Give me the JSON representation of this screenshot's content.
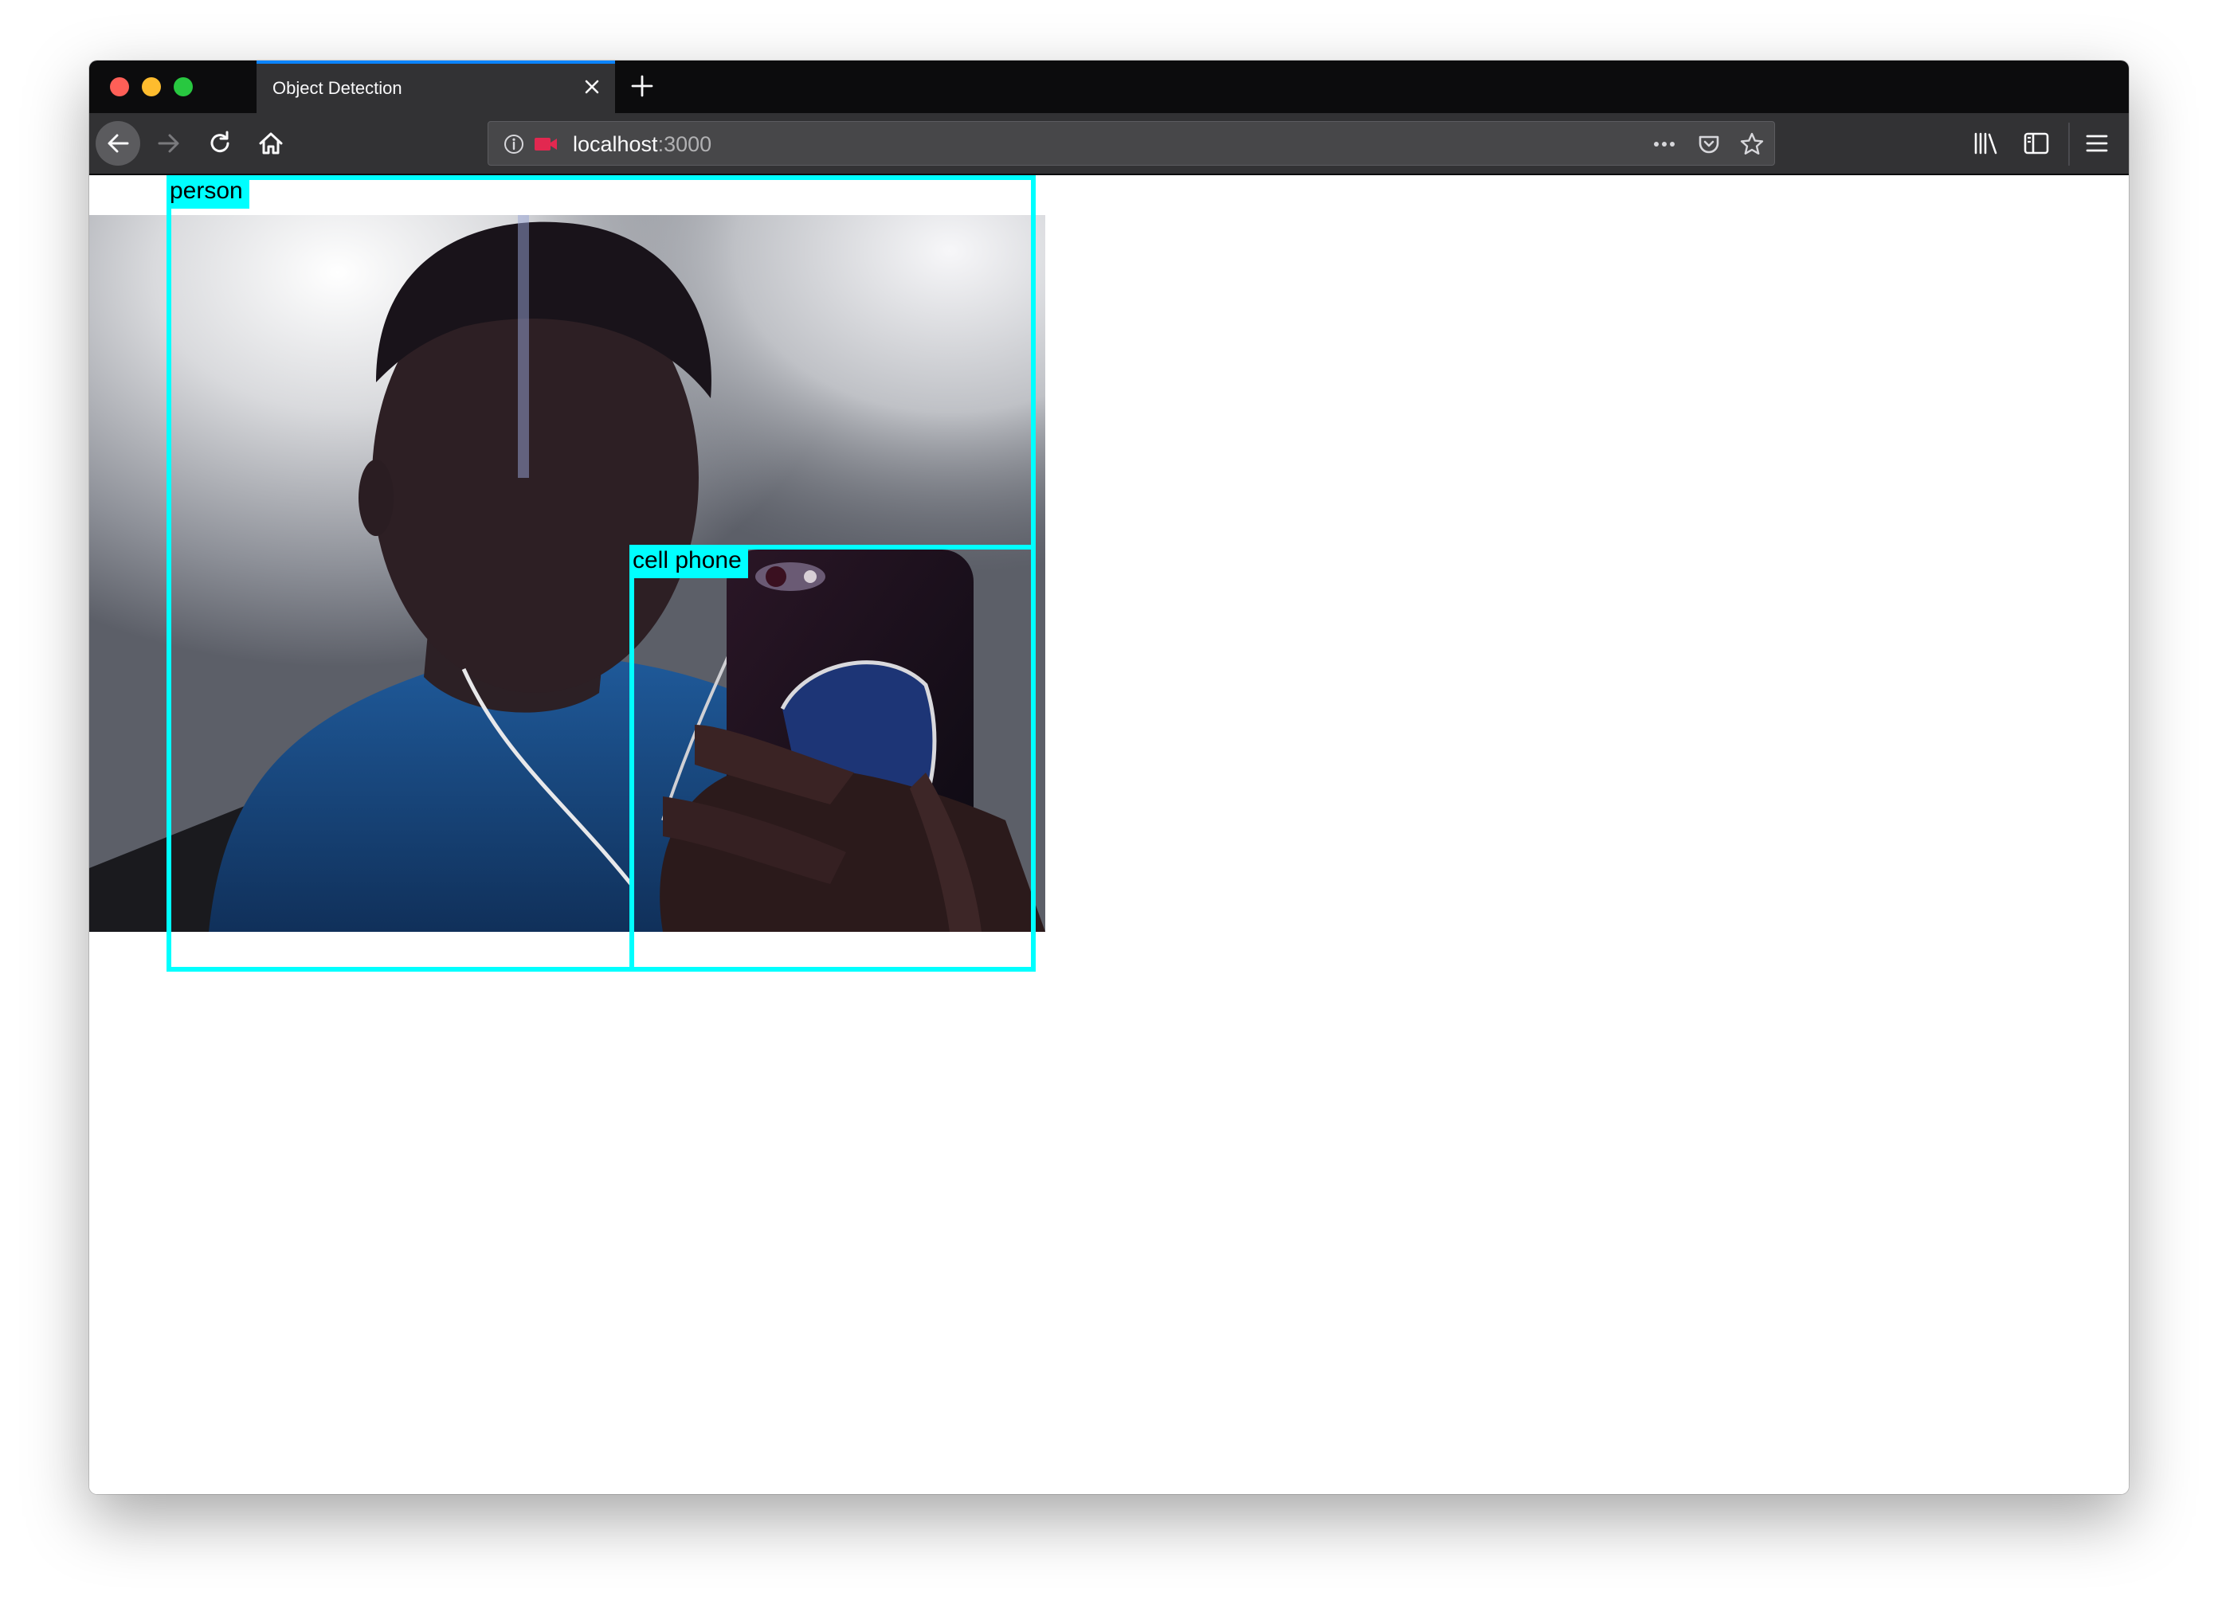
{
  "browser": {
    "tab": {
      "title": "Object Detection",
      "accent": "#0a84ff"
    },
    "url": {
      "host": "localhost",
      "port": ":3000"
    },
    "icons": {
      "back": "arrow-left-icon",
      "forward": "arrow-right-icon",
      "reload": "reload-icon",
      "home": "home-icon",
      "info": "info-icon",
      "camera": "camera-icon",
      "more": "more-dots-icon",
      "pocket": "pocket-icon",
      "bookmark": "star-icon",
      "library": "library-icon",
      "sidebar": "sidebar-icon",
      "menu": "hamburger-menu-icon"
    }
  },
  "detections": [
    {
      "label": "person",
      "color": "#00ffff"
    },
    {
      "label": "cell phone",
      "color": "#00ffff"
    }
  ]
}
